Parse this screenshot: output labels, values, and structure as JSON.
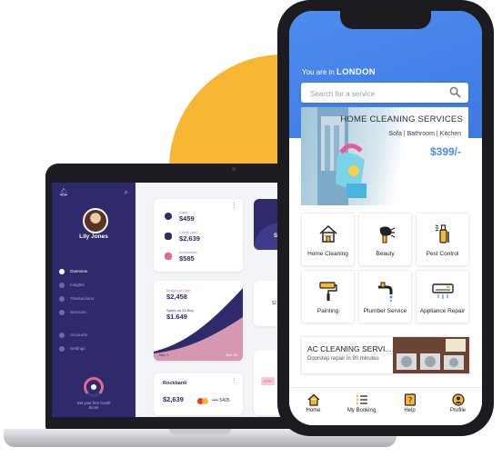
{
  "colors": {
    "accent": "#4c8cf0",
    "sidebar": "#2e2a6b",
    "yellow": "#f7b733",
    "pink": "#e16a8d"
  },
  "laptop": {
    "user_name": "Lily Jones",
    "menu": [
      "Overview",
      "Insights",
      "Transactions",
      "Services",
      "Accounts",
      "Settings"
    ],
    "credit_score": "Get your free Credit Score",
    "balances": [
      {
        "label": "Cash",
        "value": "$459"
      },
      {
        "label": "Credit card",
        "value": "$2.639"
      },
      {
        "label": "Investment",
        "value": "$585"
      }
    ],
    "budget_label": "Budget on Sep",
    "budget_value": "$2,458",
    "spent_label": "Spent on 24 Sep",
    "spent_value": "$1.649",
    "chart_start": "Nov 1",
    "chart_end": "Nov 30",
    "rockbank_title": "Rockbank",
    "rockbank_amount": "$2,639",
    "card_mask": "•••• 5405",
    "partial_val": "$2,458",
    "partial_sa": "Sa",
    "partial_pct": "53%",
    "partial_val2": "$2"
  },
  "app": {
    "location_prefix": "You are in",
    "location": "LONDON",
    "search_placeholder": "Search for a service",
    "banner": {
      "title": "HOME CLEANING SERVICES",
      "subtitle": "Sofa | Bathroom | Kitchen",
      "price": "$399/-"
    },
    "services": [
      "Home Cleaning",
      "Beauty",
      "Pest Control",
      "Painting",
      "Plumber Service",
      "Appliance Repair"
    ],
    "promo": {
      "title": "AC CLEANING SERVI...",
      "subtitle": "Doorstep repair in 90 minutes"
    },
    "tabs": [
      "Home",
      "My Booking",
      "Help",
      "Profile"
    ]
  }
}
